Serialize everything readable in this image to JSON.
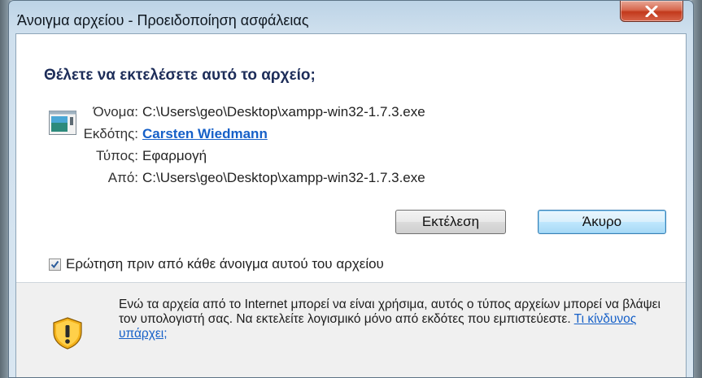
{
  "window": {
    "title": "Άνοιγμα αρχείου - Προειδοποίηση ασφάλειας",
    "close_icon": "close-icon"
  },
  "question": "Θέλετε να εκτελέσετε αυτό το αρχείο;",
  "file_icon": "application-file-icon",
  "info": {
    "name_label": "Όνομα:",
    "name_value": "C:\\Users\\geo\\Desktop\\xampp-win32-1.7.3.exe",
    "publisher_label": "Εκδότης:",
    "publisher_value": "Carsten Wiedmann",
    "type_label": "Τύπος:",
    "type_value": "Εφαρμογή",
    "from_label": "Από:",
    "from_value": "C:\\Users\\geo\\Desktop\\xampp-win32-1.7.3.exe"
  },
  "buttons": {
    "run_label": "Εκτέλεση",
    "cancel_label": "Άκυρο"
  },
  "checkbox": {
    "label": "Ερώτηση πριν από κάθε άνοιγμα αυτού του αρχείου",
    "checked": true
  },
  "warning": {
    "icon": "shield-warning-icon",
    "text": "Ενώ τα αρχεία από το Internet μπορεί να είναι χρήσιμα, αυτός ο τύπος αρχείων μπορεί να βλάψει τον υπολογιστή σας. Να εκτελείτε λογισμικό μόνο από εκδότες που εμπιστεύεστε. ",
    "link": "Τι κίνδυνος υπάρχει;"
  },
  "colors": {
    "heading": "#1d2d59",
    "link": "#1660c8",
    "close_button": "#c2391c"
  }
}
